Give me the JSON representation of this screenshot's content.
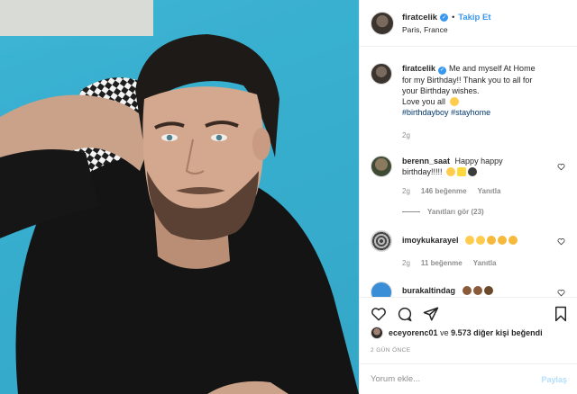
{
  "post": {
    "username": "firatcelik",
    "follow_label": "Takip Et",
    "separator": "•",
    "location": "Paris, France"
  },
  "caption": {
    "username": "firatcelik",
    "text_lines": [
      "Me and myself At Home",
      "for my Birthday!! Thank you to all for",
      "your Birthday wishes.",
      "Love you all"
    ],
    "hashtags": [
      "#birthdayboy",
      "#stayhome"
    ],
    "age": "2g"
  },
  "comments": [
    {
      "username": "berenn_saat",
      "text": "Happy happy",
      "text2": "birthday!!!!!",
      "age": "2g",
      "likes": "146 beğenme",
      "reply": "Yanıtla",
      "view_replies": "Yanıtları gör (23)"
    },
    {
      "username": "imoykukarayel",
      "text": "",
      "age": "2g",
      "likes": "11 beğenme",
      "reply": "Yanıtla"
    },
    {
      "username": "burakaltindag",
      "text": ""
    }
  ],
  "likes": {
    "liker": "eceyorenc01",
    "connector": "ve",
    "count": "9.573",
    "suffix": "diğer kişi beğendi"
  },
  "timestamp": "2 GÜN ÖNCE",
  "add_comment": {
    "placeholder": "Yorum ekle...",
    "post_label": "Paylaş"
  },
  "icons": [
    "heart-icon",
    "comment-icon",
    "share-icon",
    "bookmark-icon",
    "verified-badge-icon",
    "kiss-emoji",
    "smile-emoji"
  ],
  "colors": {
    "accent": "#3897f0",
    "hashtag": "#00376b",
    "muted": "#8e8e8e",
    "photo_bg": "#3fb6d6"
  }
}
